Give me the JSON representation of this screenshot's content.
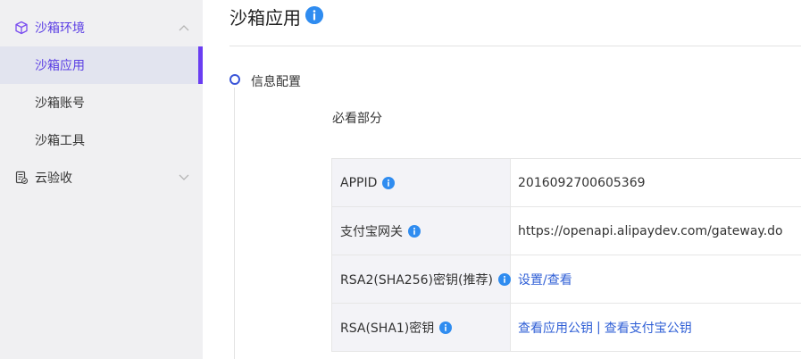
{
  "sidebar": {
    "groups": [
      {
        "label": "沙箱环境",
        "icon": "cube-icon",
        "expanded": true,
        "items": [
          {
            "label": "沙箱应用",
            "active": true
          },
          {
            "label": "沙箱账号",
            "active": false
          },
          {
            "label": "沙箱工具",
            "active": false
          }
        ]
      },
      {
        "label": "云验收",
        "icon": "document-check-icon",
        "expanded": false
      }
    ]
  },
  "main": {
    "title": "沙箱应用",
    "title_icon": "info-icon",
    "step": {
      "title": "信息配置",
      "section": "必看部分"
    },
    "rows": [
      {
        "key": "APPID",
        "value": "2016092700605369"
      },
      {
        "key": "支付宝网关",
        "value": "https://openapi.alipaydev.com/gateway.do"
      },
      {
        "key": "RSA2(SHA256)密钥(推荐)",
        "link": "设置/查看"
      },
      {
        "key": "RSA(SHA1)密钥",
        "link_a": "查看应用公钥",
        "separator": "|",
        "link_b": "查看支付宝公钥"
      }
    ]
  },
  "colors": {
    "accent": "#6a3df2",
    "active_text": "#5b3fe4",
    "link": "#2f5fd6",
    "info": "#2f8cf0",
    "sidebar_bg": "#f0f0f2"
  }
}
